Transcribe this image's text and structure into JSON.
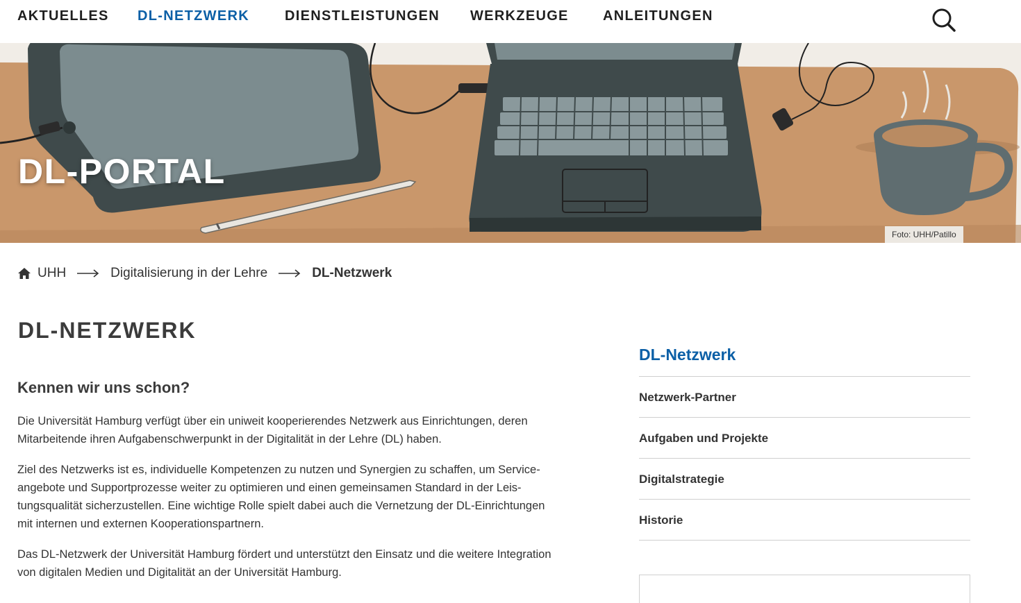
{
  "nav": {
    "items": [
      {
        "label": "AKTUELLES"
      },
      {
        "label": "DL-NETZWERK"
      },
      {
        "label": "DIENSTLEISTUNGEN"
      },
      {
        "label": "WERKZEUGE"
      },
      {
        "label": "ANLEITUNGEN"
      }
    ],
    "search_icon": "search-icon",
    "active_color": "#0b5fa6"
  },
  "hero": {
    "title": "DL-PORTAL",
    "photo_credit": "Foto: UHH/Patillo"
  },
  "breadcrumb": {
    "home_icon": "home-icon",
    "items": [
      "UHH",
      "Digitalisierung in der Lehre",
      "DL-Netzwerk"
    ]
  },
  "main": {
    "page_title": "DL-NETZWERK",
    "heading": "Kennen wir uns schon?",
    "paragraphs": [
      "Die Universität Hamburg verfügt über ein uniweit kooperierendes Netzwerk aus Einrichtungen, deren Mitarbeitende ihren Aufgabenschwerpunkt in der Digitalität in der Lehre (DL) haben.",
      "Ziel des Netzwerks ist es, individuelle Kompetenzen zu nutzen und Synergien zu schaffen, um Service­angebote und Supportprozesse weiter zu optimieren und einen gemeinsamen Standard in der Leis­tungsqualität sicherzustellen. Eine wichtige Rolle spielt dabei auch die Vernetzung der DL-Einrichtungen mit internen und externen Kooperationspartnern.",
      "Das DL-Netzwerk der Universität Hamburg fördert und unterstützt den Einsatz und die weitere Inte­gration von digitalen Medien und Digitalität an der Universität Hamburg."
    ]
  },
  "sidebar": {
    "title": "DL-Netzwerk",
    "items": [
      "Netzwerk-Partner",
      "Aufgaben und Projekte",
      "Digitalstrategie",
      "Historie"
    ]
  }
}
